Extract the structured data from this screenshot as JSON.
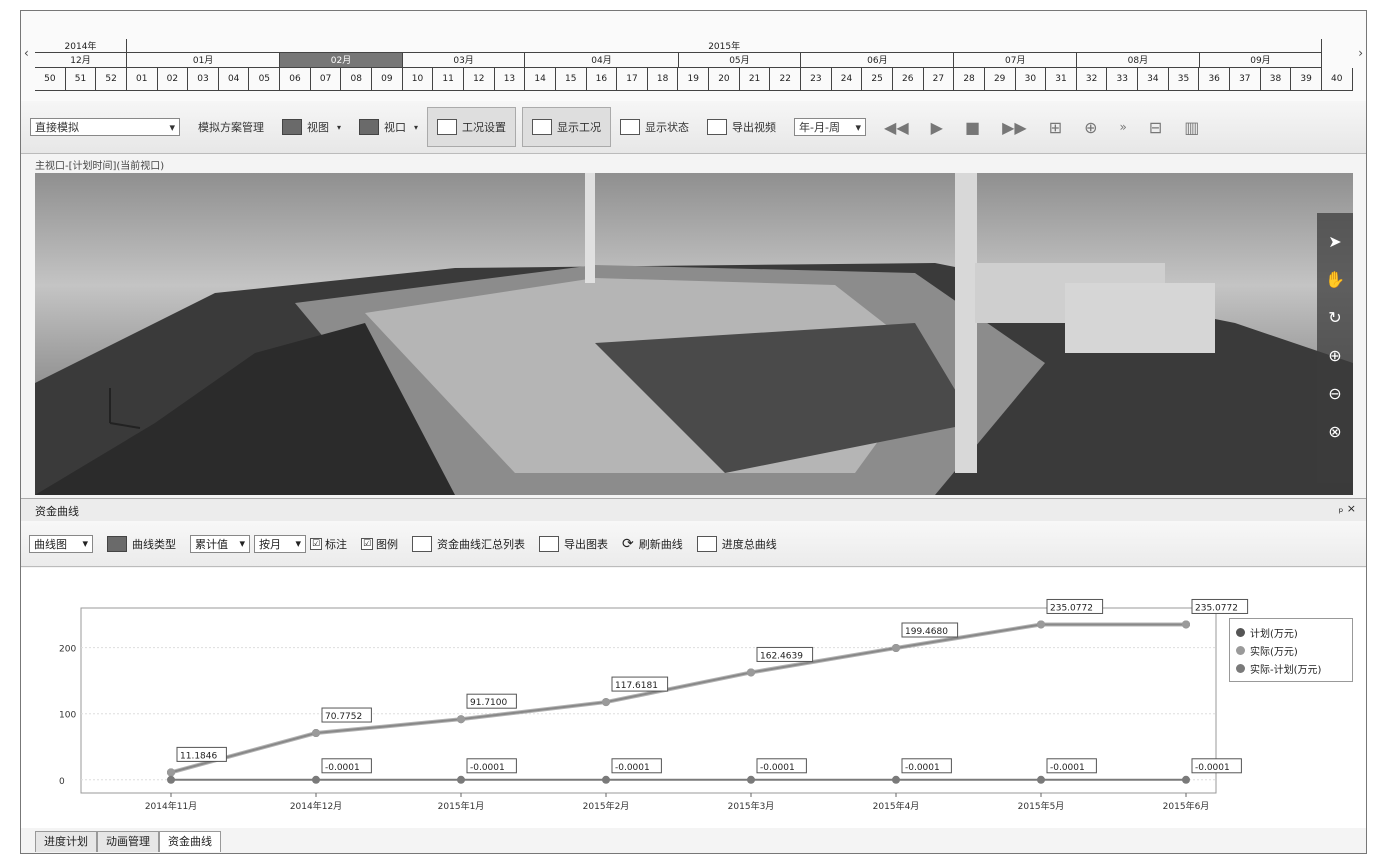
{
  "timeline": {
    "years": [
      {
        "label": "2014年",
        "span": 3
      },
      {
        "label": "2015年",
        "span": 39
      }
    ],
    "months": [
      {
        "label": "12月",
        "span": 3
      },
      {
        "label": "01月",
        "span": 5
      },
      {
        "label": "02月",
        "span": 4,
        "selected": true
      },
      {
        "label": "03月",
        "span": 4
      },
      {
        "label": "04月",
        "span": 5
      },
      {
        "label": "05月",
        "span": 4
      },
      {
        "label": "06月",
        "span": 5
      },
      {
        "label": "07月",
        "span": 4
      },
      {
        "label": "08月",
        "span": 4
      },
      {
        "label": "09月",
        "span": 4
      }
    ],
    "weeks": [
      "50",
      "51",
      "52",
      "01",
      "02",
      "03",
      "04",
      "05",
      "06",
      "07",
      "08",
      "09",
      "10",
      "11",
      "12",
      "13",
      "14",
      "15",
      "16",
      "17",
      "18",
      "19",
      "20",
      "21",
      "22",
      "23",
      "24",
      "25",
      "26",
      "27",
      "28",
      "29",
      "30",
      "31",
      "32",
      "33",
      "34",
      "35",
      "36",
      "37",
      "38",
      "39",
      "40"
    ],
    "left_arrow": "‹",
    "right_arrow": "›"
  },
  "toolbar": {
    "mode_select": "直接模拟",
    "scheme_mgmt": "模拟方案管理",
    "view_btn": "视图",
    "window_btn": "视口",
    "condition_settings": "工况设置",
    "show_condition": "显示工况",
    "show_state": "显示状态",
    "export_video": "导出视频",
    "date_format": "年-月-周"
  },
  "breadcrumb": "主视口-[计划时间](当前视口)",
  "panel": {
    "title": "资金曲线",
    "close": "ₚ ×"
  },
  "curve_toolbar": {
    "chart_type": "曲线图",
    "curve_type": "曲线类型",
    "accumulate": "累计值",
    "by_month": "按月",
    "annotate": "标注",
    "legend": "图例",
    "summary_list": "资金曲线汇总列表",
    "export_chart": "导出图表",
    "refresh_curve": "刷新曲线",
    "progress_curve": "进度总曲线",
    "check_mark": "☑"
  },
  "chart_data": {
    "type": "line",
    "categories": [
      "2014年11月",
      "2014年12月",
      "2015年1月",
      "2015年2月",
      "2015年3月",
      "2015年4月",
      "2015年5月",
      "2015年6月"
    ],
    "series": [
      {
        "name": "计划(万元)",
        "color": "#555555",
        "values": [
          11.1846,
          70.7752,
          91.71,
          117.6181,
          162.4639,
          199.468,
          235.0772,
          235.0772
        ]
      },
      {
        "name": "实际(万元)",
        "color": "#9a9a9a",
        "values": [
          11.1846,
          70.7752,
          91.71,
          117.6181,
          162.4639,
          199.468,
          235.0772,
          235.0772
        ]
      },
      {
        "name": "实际-计划(万元)",
        "color": "#7a7a7a",
        "values": [
          0,
          0,
          0,
          0,
          0,
          0,
          0,
          0
        ]
      }
    ],
    "data_labels_top": [
      "11.1846",
      "70.7752",
      "91.7100",
      "117.6181",
      "162.4639",
      "199.4680",
      "235.0772",
      "235.0772"
    ],
    "data_labels_bottom": [
      "",
      "-0.0001",
      "-0.0001",
      "-0.0001",
      "-0.0001",
      "-0.0001",
      "-0.0001",
      "-0.0001"
    ],
    "yticks": [
      0,
      100,
      200
    ],
    "ylim": [
      -20,
      260
    ],
    "grid": true,
    "legend_position": "top-right"
  },
  "tabs": [
    "进度计划",
    "动画管理",
    "资金曲线"
  ],
  "active_tab": 2
}
